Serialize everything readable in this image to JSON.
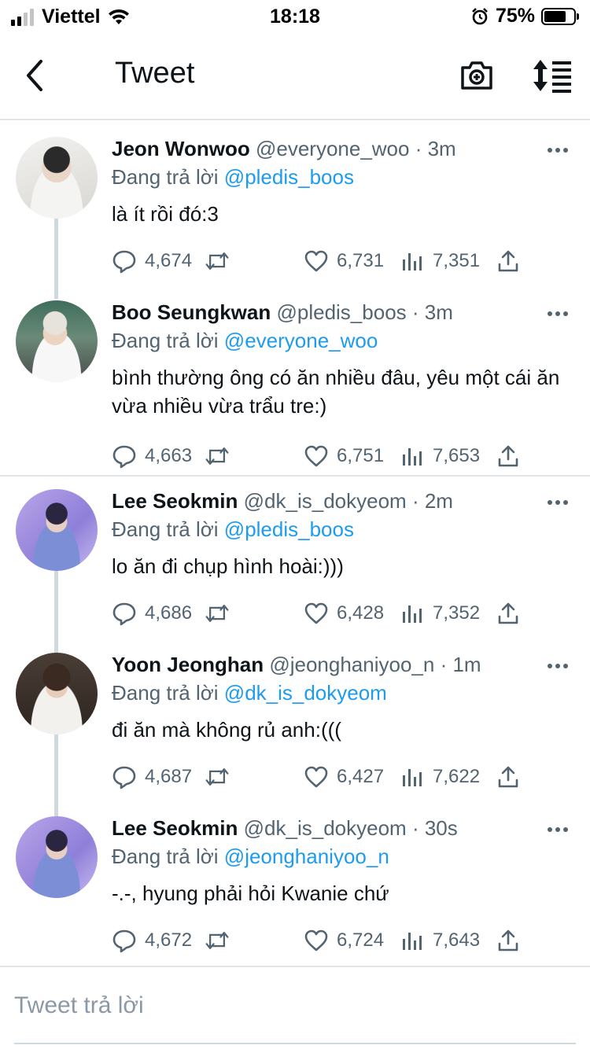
{
  "status_bar": {
    "carrier": "Viettel",
    "time": "18:18",
    "battery_percent": "75%",
    "battery_level": 0.75,
    "signal_bars": 2
  },
  "nav": {
    "title": "Tweet",
    "back_icon": "chevron-left-icon",
    "camera_icon": "camera-plus-icon",
    "sort_icon": "sort-icon"
  },
  "colors": {
    "link": "#1d9bf0",
    "muted": "#536471",
    "thread_line": "#cfd9de"
  },
  "tweets": [
    {
      "name": "Jeon Wonwoo",
      "handle": "@everyone_woo",
      "time": "· 3m",
      "replying_label": "Đang trả lời",
      "replying_to": "@pledis_boos",
      "text": "là ít rồi đó:3",
      "replies": "4,674",
      "likes": "6,731",
      "views": "7,351"
    },
    {
      "name": "Boo Seungkwan",
      "handle": "@pledis_boos",
      "time": "· 3m",
      "replying_label": "Đang trả lời",
      "replying_to": "@everyone_woo",
      "text": "bình thường ông có ăn nhiều đâu, yêu một cái ăn vừa nhiều vừa trẩu tre:)",
      "replies": "4,663",
      "likes": "6,751",
      "views": "7,653"
    },
    {
      "name": "Lee Seokmin",
      "handle": "@dk_is_dokyeom",
      "time": "· 2m",
      "replying_label": "Đang trả lời",
      "replying_to": "@pledis_boos",
      "text": "lo ăn đi chụp hình hoài:)))",
      "replies": "4,686",
      "likes": "6,428",
      "views": "7,352"
    },
    {
      "name": "Yoon Jeonghan",
      "handle": "@jeonghaniyoo_n",
      "time": "· 1m",
      "replying_label": "Đang trả lời",
      "replying_to": "@dk_is_dokyeom",
      "text": "đi ăn mà không rủ anh:(((",
      "replies": "4,687",
      "likes": "6,427",
      "views": "7,622"
    },
    {
      "name": "Lee Seokmin",
      "handle": "@dk_is_dokyeom",
      "time": "· 30s",
      "replying_label": "Đang trả lời",
      "replying_to": "@jeonghaniyoo_n",
      "text": "-.-, hyung phải hỏi Kwanie chứ",
      "replies": "4,672",
      "likes": "6,724",
      "views": "7,643"
    }
  ],
  "reply_box": {
    "placeholder": "Tweet trả lời"
  }
}
